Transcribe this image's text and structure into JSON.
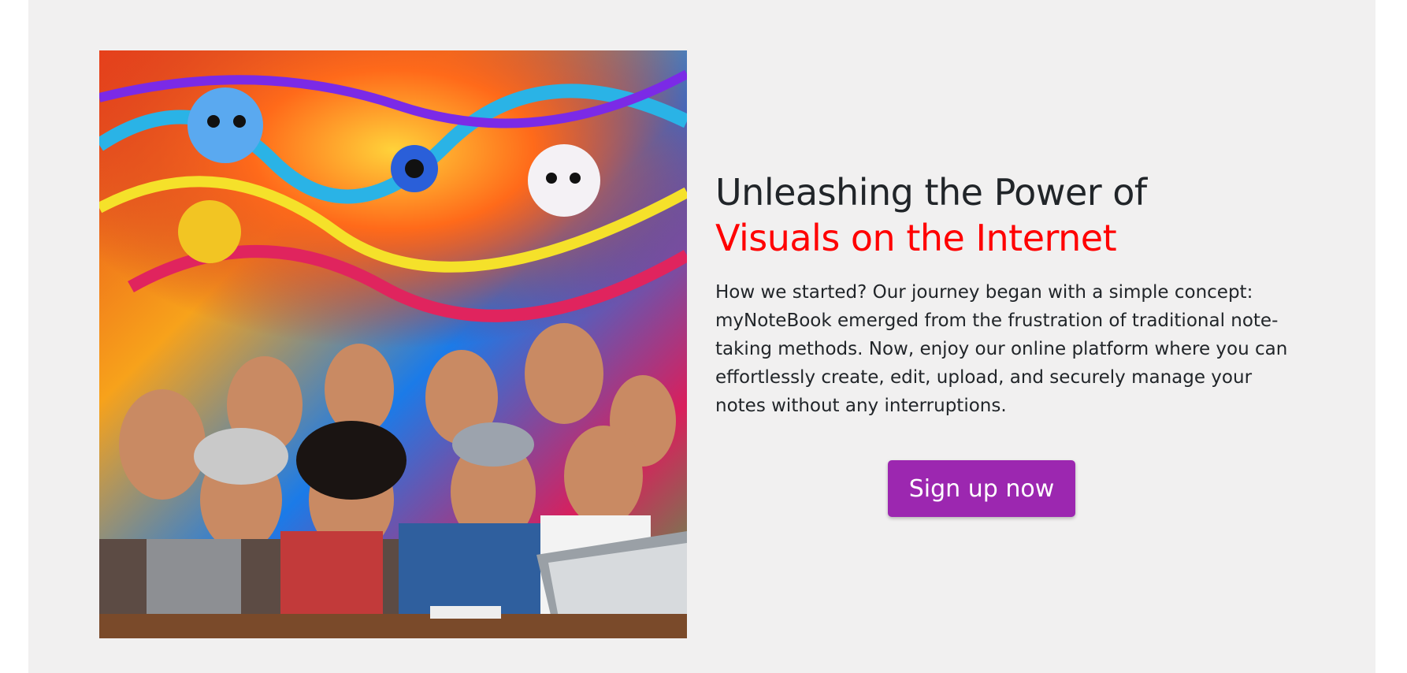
{
  "hero": {
    "headline_line1": "Unleashing the Power of",
    "headline_line2": "Visuals on the Internet",
    "description": "How we started? Our journey began with a simple concept: myNoteBook emerged from the frustration of traditional note-taking methods. Now, enjoy our online platform where you can effortlessly create, edit, upload, and securely manage your notes without any interruptions.",
    "cta_label": "Sign up now",
    "accent_color": "#ff0000",
    "button_color": "#9c27b0"
  }
}
